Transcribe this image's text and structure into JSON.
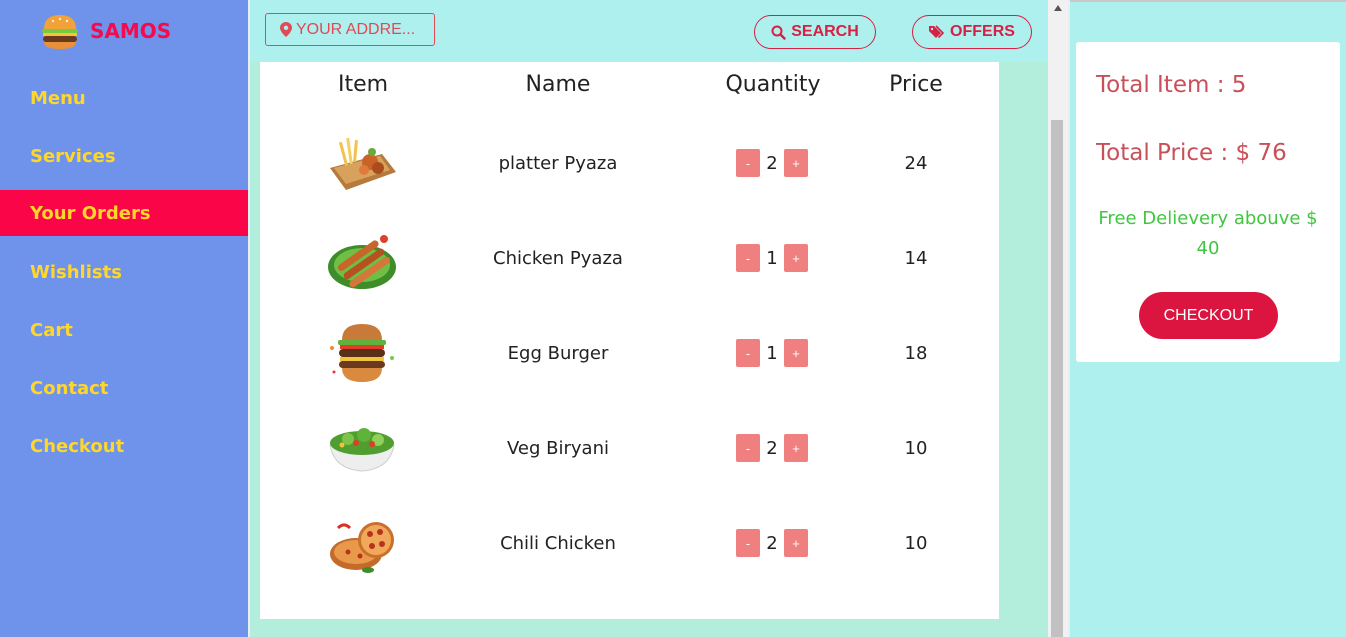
{
  "brand": {
    "name": "SAMOS",
    "icon": "burger-icon"
  },
  "nav": [
    {
      "label": "Menu",
      "active": false
    },
    {
      "label": "Services",
      "active": false
    },
    {
      "label": "Your Orders",
      "active": true
    },
    {
      "label": "Wishlists",
      "active": false
    },
    {
      "label": "Cart",
      "active": false
    },
    {
      "label": "Contact",
      "active": false
    },
    {
      "label": "Checkout",
      "active": false
    }
  ],
  "topbar": {
    "address_label": "YOUR ADDRE...",
    "search_label": "SEARCH",
    "offers_label": "OFFERS"
  },
  "table": {
    "headers": [
      "Item",
      "Name",
      "Quantity",
      "Price"
    ],
    "rows": [
      {
        "image": "platter-image",
        "name": "platter Pyaza",
        "qty": "2",
        "price": "24"
      },
      {
        "image": "kebab-image",
        "name": "Chicken Pyaza",
        "qty": "1",
        "price": "14"
      },
      {
        "image": "burger-image",
        "name": "Egg Burger",
        "qty": "1",
        "price": "18"
      },
      {
        "image": "salad-image",
        "name": "Veg Biryani",
        "qty": "2",
        "price": "10"
      },
      {
        "image": "pizza-image",
        "name": "Chili Chicken",
        "qty": "2",
        "price": "10"
      }
    ],
    "minus_label": "-",
    "plus_label": "+"
  },
  "summary": {
    "total_items": "Total Item : 5",
    "total_price": "Total Price : $ 76",
    "free_delivery": "Free Delievery abouve $ 40",
    "checkout_label": "CHECKOUT"
  },
  "colors": {
    "sidebar": "#6f93ea",
    "active": "#fb0549",
    "nav_text": "#ffd62a",
    "accent": "#dc1440",
    "background": "#aef0ee"
  }
}
